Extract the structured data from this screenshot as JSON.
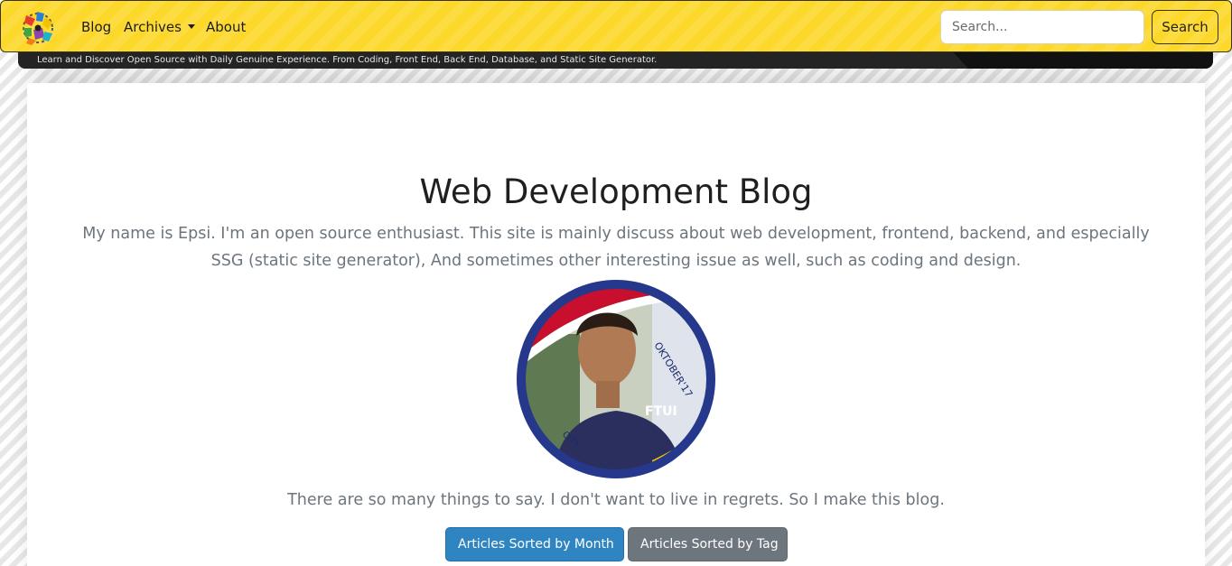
{
  "navbar": {
    "logo": "colorful-gears-logo",
    "links": {
      "blog": "Blog",
      "archives": "Archives",
      "about": "About"
    },
    "search": {
      "placeholder": "Search...",
      "button_label": "Search"
    },
    "tagline": "Learn and Discover Open Source with Daily Genuine Experience. From Coding, Front End, Back End, Database, and Static Site Generator."
  },
  "hero": {
    "title": "Web Development Blog",
    "intro": "My name is Epsi. I'm an open source enthusiast. This site is mainly discuss about web development, frontend, backend, and especially SSG (static site generator), And sometimes other interesting issue as well, such as coding and design.",
    "avatar": "profile-photo",
    "avatar_badge": "FTUI",
    "avatar_ring_text": [
      "OKTOBER'17",
      "CITY"
    ],
    "tagline": "There are so many things to say. I don't want to live in regrets. So I make this blog.",
    "buttons": {
      "by_month": "Articles Sorted by Month",
      "by_tag": "Articles Sorted by Tag"
    }
  },
  "colors": {
    "navbar_yellow": "#fcd82b",
    "tagline_bar": "#111111",
    "primary_button": "#2f84c2",
    "secondary_button": "#6e767d",
    "muted_text": "#6c757d"
  }
}
